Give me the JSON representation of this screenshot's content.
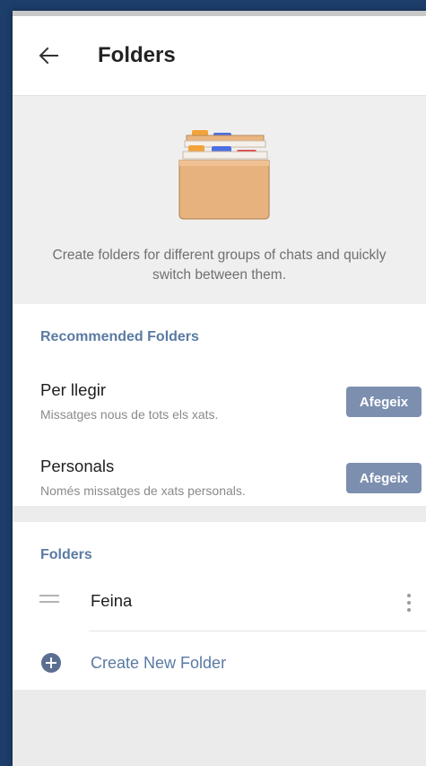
{
  "header": {
    "title": "Folders",
    "back_icon": "arrow-left-icon"
  },
  "hero": {
    "illustration": "folder-cabinet-icon",
    "description": "Create folders for different groups of chats and quickly switch between them."
  },
  "recommended": {
    "header": "Recommended Folders",
    "items": [
      {
        "title": "Per llegir",
        "subtitle": "Missatges nous de tots els xats.",
        "action": "Afegeix"
      },
      {
        "title": "Personals",
        "subtitle": "Només missatges de xats personals.",
        "action": "Afegeix"
      }
    ]
  },
  "folders": {
    "header": "Folders",
    "items": [
      {
        "name": "Feina",
        "handle_icon": "drag-handle-icon",
        "menu_icon": "more-vertical-icon"
      }
    ],
    "create_label": "Create New Folder",
    "create_icon": "plus-circle-icon"
  },
  "colors": {
    "accent": "#5a7aa3",
    "button": "#7c8faf",
    "frame_background": "#1d3d6a"
  }
}
